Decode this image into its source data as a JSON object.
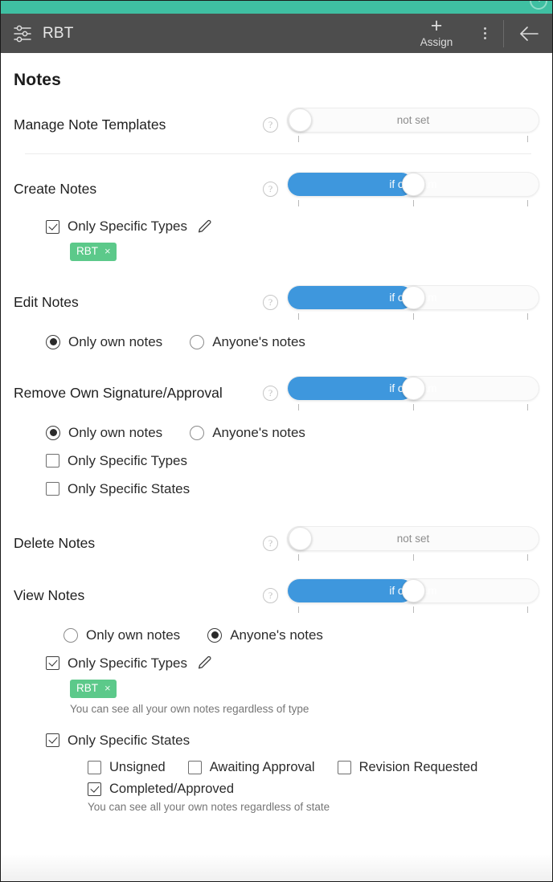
{
  "header": {
    "title": "RBT",
    "sliders_icon": "sliders-icon",
    "assign_label": "Assign",
    "assign_plus": "+",
    "kebab_icon": "more-vertical-icon",
    "back_icon": "arrow-left-icon",
    "help_circle_icon": "help-circle-icon"
  },
  "page": {
    "title": "Notes"
  },
  "toggle_states": {
    "not_set": "not set",
    "if_on_team": "if on team"
  },
  "help_glyph": "?",
  "pencil_icon_name": "pencil-edit-icon",
  "sections": [
    {
      "id": "manage-note-templates",
      "label": "Manage Note Templates",
      "toggle_value": "not set",
      "toggle_state": "not-set",
      "divider_after": true
    },
    {
      "id": "create-notes",
      "label": "Create Notes",
      "toggle_value": "if on team",
      "toggle_state": "if-on-team",
      "checkbox_types": {
        "label": "Only Specific Types",
        "checked": true,
        "chips": [
          {
            "label": "RBT",
            "remove": "×"
          }
        ]
      }
    },
    {
      "id": "edit-notes",
      "label": "Edit Notes",
      "toggle_value": "if on team",
      "toggle_state": "if-on-team",
      "radios": [
        {
          "label": "Only own notes",
          "selected": true
        },
        {
          "label": "Anyone's notes",
          "selected": false
        }
      ]
    },
    {
      "id": "remove-own-signature-approval",
      "label": "Remove Own Signature/Approval",
      "toggle_value": "if on team",
      "toggle_state": "if-on-team",
      "radios": [
        {
          "label": "Only own notes",
          "selected": true
        },
        {
          "label": "Anyone's notes",
          "selected": false
        }
      ],
      "checkboxes": [
        {
          "label": "Only Specific Types",
          "checked": false
        },
        {
          "label": "Only Specific States",
          "checked": false
        }
      ]
    },
    {
      "id": "delete-notes",
      "label": "Delete Notes",
      "toggle_value": "not set",
      "toggle_state": "not-set"
    },
    {
      "id": "view-notes",
      "label": "View Notes",
      "toggle_value": "if on team",
      "toggle_state": "if-on-team",
      "radios": [
        {
          "label": "Only own notes",
          "selected": false
        },
        {
          "label": "Anyone's notes",
          "selected": true
        }
      ],
      "checkbox_types": {
        "label": "Only Specific Types",
        "checked": true,
        "chips": [
          {
            "label": "RBT",
            "remove": "×"
          }
        ],
        "hint": "You can see all your own notes regardless of type"
      },
      "checkbox_states": {
        "label": "Only Specific States",
        "checked": true,
        "options": [
          {
            "label": "Unsigned",
            "checked": false
          },
          {
            "label": "Awaiting Approval",
            "checked": false
          },
          {
            "label": "Revision Requested",
            "checked": false
          },
          {
            "label": "Completed/Approved",
            "checked": true
          }
        ],
        "hint": "You can see all your own notes regardless of state"
      }
    }
  ],
  "colors": {
    "teal": "#3fbfa2",
    "header_dark": "#4d4d4d",
    "toggle_blue": "#3e97dd",
    "chip_green": "#5cc98a"
  }
}
